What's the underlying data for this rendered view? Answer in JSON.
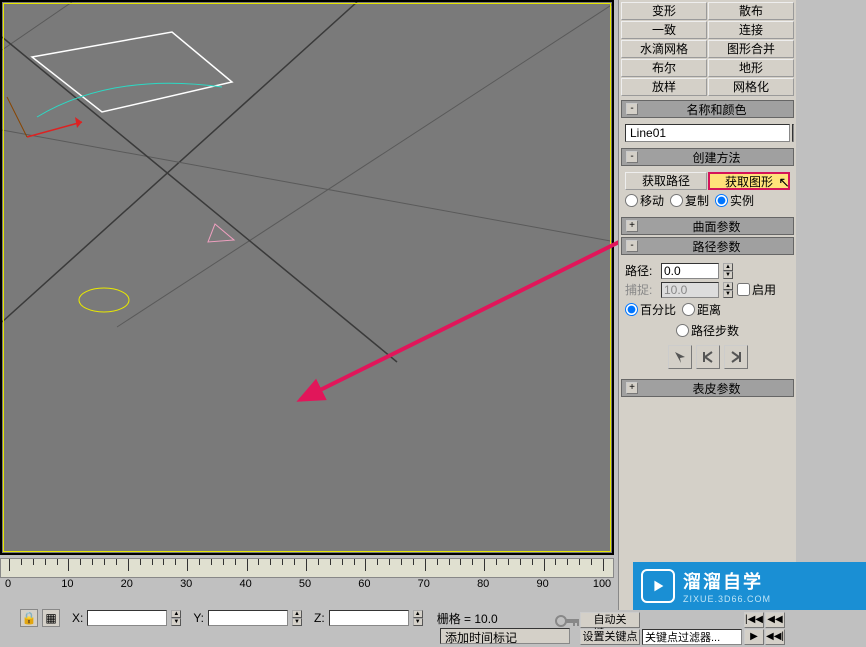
{
  "toolbar_buttons": [
    [
      "变形",
      "散布"
    ],
    [
      "一致",
      "连接"
    ],
    [
      "水滴网格",
      "图形合并"
    ],
    [
      "布尔",
      "地形"
    ],
    [
      "放样",
      "网格化"
    ]
  ],
  "name_color": {
    "header": "名称和颜色",
    "value": "Line01",
    "color": "#6be0c8"
  },
  "create_method": {
    "header": "创建方法",
    "get_path": "获取路径",
    "get_shape": "获取图形",
    "opts": {
      "move": "移动",
      "copy": "复制",
      "instance": "实例"
    }
  },
  "surface_params": {
    "header": "曲面参数"
  },
  "path_params": {
    "header": "路径参数",
    "path_label": "路径:",
    "path_value": "0.0",
    "snap_label": "捕捉:",
    "snap_value": "10.0",
    "enable": "启用",
    "percent": "百分比",
    "distance": "距离",
    "steps": "路径步数"
  },
  "skin_params": {
    "header": "表皮参数"
  },
  "ruler": {
    "labels": [
      "0",
      "10",
      "20",
      "30",
      "40",
      "50",
      "60",
      "70",
      "80",
      "90",
      "100"
    ]
  },
  "coords": {
    "x": "X:",
    "y": "Y:",
    "z": "Z:",
    "grid": "栅格 = 10.0"
  },
  "bottom": {
    "add_marker": "添加时间标记",
    "auto_key": "自动关键……",
    "set_key": "设置关键点",
    "key_filter": "关键点过滤器..."
  },
  "logo": {
    "title": "溜溜自学",
    "sub": "ZIXUE.3D66.COM"
  },
  "transport": [
    "|◀◀",
    "◀◀",
    "▶",
    "◀◀|"
  ]
}
